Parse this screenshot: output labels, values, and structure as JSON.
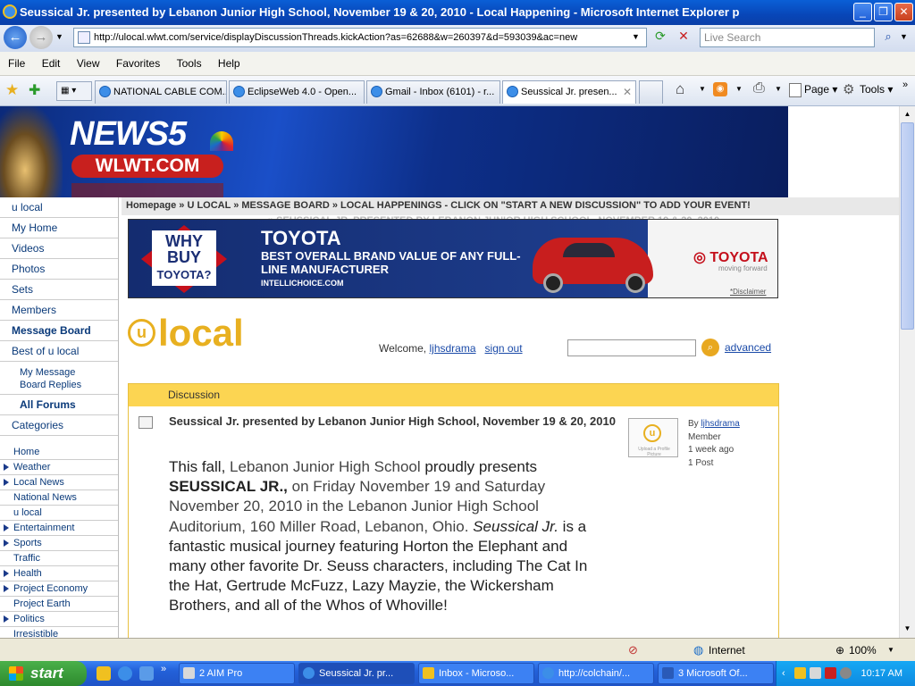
{
  "window": {
    "title": "Seussical Jr. presented by Lebanon Junior High School, November 19 & 20, 2010 - Local Happening - Microsoft Internet Explorer p"
  },
  "address": {
    "url": "http://ulocal.wlwt.com/service/displayDiscussionThreads.kickAction?as=62688&w=260397&d=593039&ac=new",
    "search_placeholder": "Live Search"
  },
  "menu": [
    "File",
    "Edit",
    "View",
    "Favorites",
    "Tools",
    "Help"
  ],
  "tabs": [
    {
      "label": "NATIONAL CABLE COM..."
    },
    {
      "label": "EclipseWeb 4.0 - Open..."
    },
    {
      "label": "Gmail - Inbox (6101) - r..."
    },
    {
      "label": "Seussical Jr. presen..."
    }
  ],
  "toolbar": {
    "page_label": "Page",
    "tools_label": "Tools"
  },
  "banner": {
    "news5": "NEWS5",
    "wlwt": "WLWT.COM"
  },
  "leftnav": {
    "top": [
      "u local",
      "My Home",
      "Videos",
      "Photos",
      "Sets",
      "Members",
      "Message Board",
      "Best of u local"
    ],
    "sub": [
      "My Message",
      "Board Replies"
    ],
    "forums": "All Forums",
    "categories": "Categories",
    "sections": [
      {
        "label": "Home",
        "arrow": false
      },
      {
        "label": "Weather",
        "arrow": true
      },
      {
        "label": "Local News",
        "arrow": true
      },
      {
        "label": "National News",
        "arrow": false
      },
      {
        "label": "u local",
        "arrow": false
      },
      {
        "label": "Entertainment",
        "arrow": true
      },
      {
        "label": "Sports",
        "arrow": true
      },
      {
        "label": "Traffic",
        "arrow": false
      },
      {
        "label": "Health",
        "arrow": true
      },
      {
        "label": "Project Economy",
        "arrow": true
      },
      {
        "label": "Project Earth",
        "arrow": false
      },
      {
        "label": "Politics",
        "arrow": true
      },
      {
        "label": "Irresistible",
        "arrow": false
      }
    ]
  },
  "breadcrumb": {
    "items": "Homepage  »  U LOCAL  »  MESSAGE BOARD  »  LOCAL HAPPENINGS - CLICK ON \"START A NEW DISCUSSION\" TO ADD YOUR EVENT!",
    "current": "» SEUSSICAL JR. PRESENTED BY LEBANON JUNIOR HIGH SCHOOL, NOVEMBER 19 & 20, 2010"
  },
  "ad": {
    "why1": "WHY",
    "why2": "BUY",
    "why3": "TOYOTA?",
    "brand": "TOYOTA",
    "headline": "BEST OVERALL BRAND  VALUE OF ANY FULL-LINE MANUFACTURER",
    "source": "INTELLICHOICE.COM",
    "logo": "TOYOTA",
    "tagline": "moving forward",
    "disclaimer": "*Disclaimer"
  },
  "ulocal": {
    "logo_u": "u",
    "logo_word": "local",
    "welcome": "Welcome,",
    "username": "ljhsdrama",
    "signout": "sign out",
    "advanced": "advanced"
  },
  "discussion": {
    "header": "Discussion",
    "title": "Seussical Jr. presented by Lebanon Junior High School, November 19 & 20, 2010",
    "body_p1": "This fall, ",
    "body_school": "Lebanon Junior High School",
    "body_p2": " proudly presents ",
    "body_show": "SEUSSICAL JR.,",
    "body_p3": " on Friday November 19 and Saturday November 20, 2010 in the Lebanon Junior High School Auditorium, 160 Miller Road, Lebanon, Ohio.  ",
    "body_italic": "Seussical Jr.",
    "body_p4": " is a fantastic musical journey featuring Horton the Elephant and many other favorite Dr. Seuss characters, including The Cat In the Hat, Gertrude McFuzz, Lazy Mayzie, the Wickersham Brothers, and all of the Whos of Whoville!",
    "avatar_caption": "Upload a Profile Picture",
    "by": "By",
    "author": "ljhsdrama",
    "role": "Member",
    "when": "1 week ago",
    "posts": "1 Post"
  },
  "status": {
    "zone": "Internet",
    "zoom": "100%"
  },
  "taskbar": {
    "start": "start",
    "tasks": [
      {
        "label": "2 AIM Pro"
      },
      {
        "label": "Seussical Jr. pr..."
      },
      {
        "label": "Inbox - Microso..."
      },
      {
        "label": "http://colchain/..."
      },
      {
        "label": "3 Microsoft Of..."
      }
    ],
    "clock": "10:17 AM"
  }
}
